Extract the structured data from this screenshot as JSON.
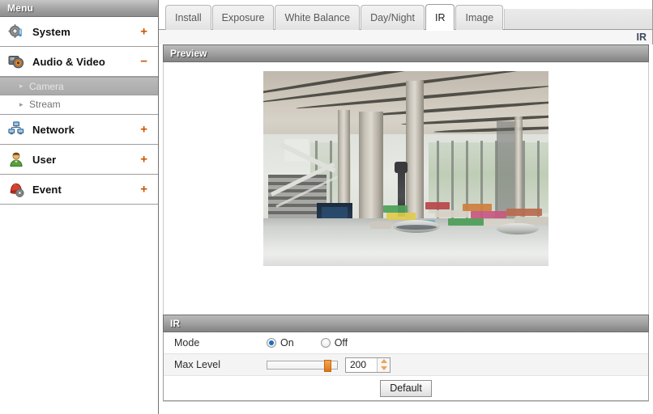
{
  "sidebar": {
    "header_label": "Menu",
    "expander_plus": "+",
    "expander_minus": "−",
    "sub_arrow": "▸",
    "items": [
      {
        "label": "System",
        "icon": "system-gear-icon",
        "expander": "+",
        "expanded": false
      },
      {
        "label": "Audio & Video",
        "icon": "camera-video-icon",
        "expander": "−",
        "expanded": true,
        "children": [
          {
            "label": "Camera",
            "active": true
          },
          {
            "label": "Stream",
            "active": false
          }
        ]
      },
      {
        "label": "Network",
        "icon": "network-monitors-icon",
        "expander": "+",
        "expanded": false
      },
      {
        "label": "User",
        "icon": "user-person-icon",
        "expander": "+",
        "expanded": false
      },
      {
        "label": "Event",
        "icon": "event-alarm-icon",
        "expander": "+",
        "expanded": false
      }
    ]
  },
  "main": {
    "tabs": [
      {
        "label": "Install",
        "active": false
      },
      {
        "label": "Exposure",
        "active": false
      },
      {
        "label": "White Balance",
        "active": false
      },
      {
        "label": "Day/Night",
        "active": false
      },
      {
        "label": "IR",
        "active": true
      },
      {
        "label": "Image",
        "active": false
      }
    ],
    "breadcrumb": "IR",
    "preview": {
      "section_title": "Preview",
      "image_alt": "live-camera-preview-lobby-atrium"
    },
    "ir": {
      "section_title": "IR",
      "mode": {
        "label": "Mode",
        "options": [
          {
            "label": "On",
            "selected": true
          },
          {
            "label": "Off",
            "selected": false
          }
        ]
      },
      "max_level": {
        "label": "Max Level",
        "value": "200",
        "min": 0,
        "max": 255,
        "slider_percent": 86
      },
      "default_button": "Default"
    }
  },
  "colors": {
    "accent_orange": "#cc5500",
    "slider_thumb": "#ec8b2d",
    "radio_checked": "#1b6ec2",
    "header_gray": "#9a9a9a",
    "breadcrumb_text": "#3c4a5c"
  }
}
